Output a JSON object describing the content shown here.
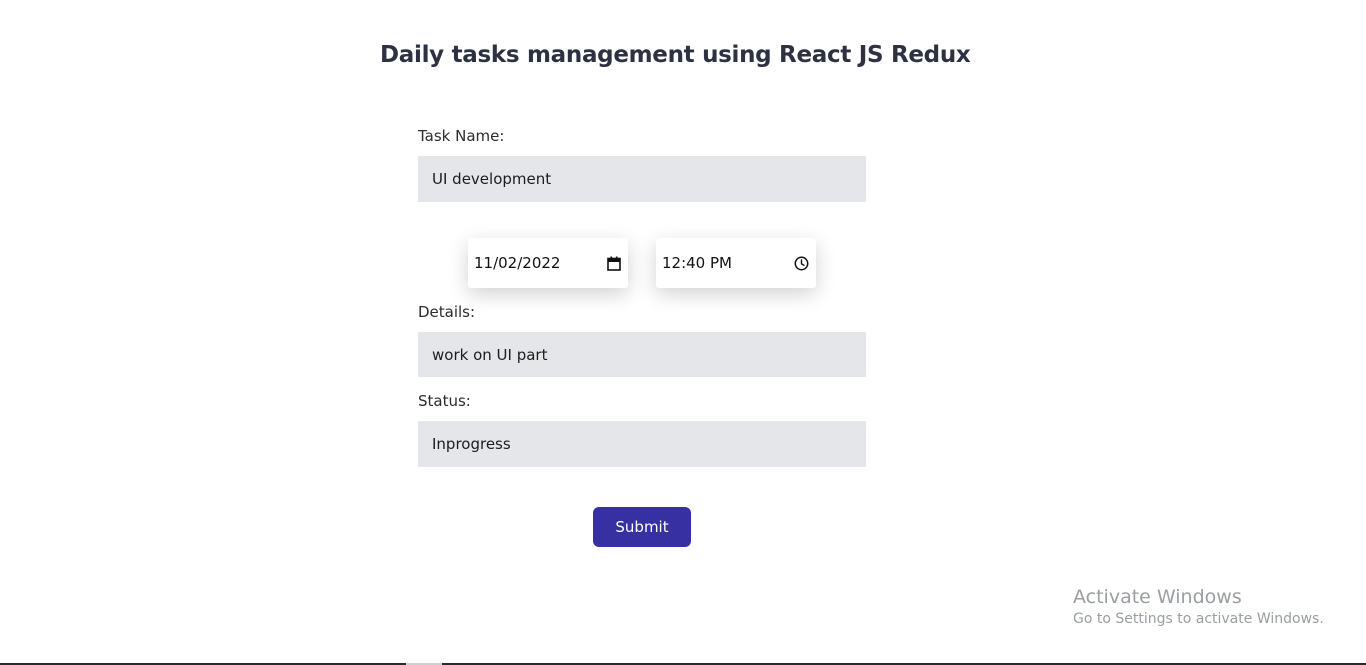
{
  "header": {
    "title": "Daily tasks management using React JS Redux"
  },
  "form": {
    "task_name": {
      "label": "Task Name:",
      "value": "UI development"
    },
    "date": {
      "value": "11/02/2022",
      "icon": "calendar-icon"
    },
    "time": {
      "value": "12:40 PM",
      "icon": "clock-icon"
    },
    "details": {
      "label": "Details:",
      "value": "work on UI part"
    },
    "status": {
      "label": "Status:",
      "value": "Inprogress"
    },
    "submit_label": "Submit"
  },
  "watermark": {
    "line1": "Activate Windows",
    "line2": "Go to Settings to activate Windows."
  },
  "colors": {
    "title": "#2d3142",
    "field_background": "#e5e6e9",
    "button": "#3730a3",
    "watermark": "#9a9ea3"
  }
}
